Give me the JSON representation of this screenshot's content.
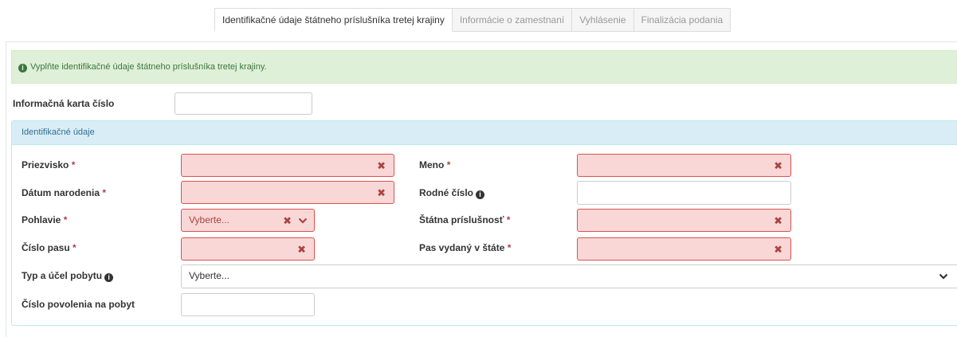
{
  "tabs": [
    {
      "label": "Identifikačné údaje štátneho príslušníka tretej krajiny",
      "active": true
    },
    {
      "label": "Informácie o zamestnaní",
      "active": false
    },
    {
      "label": "Vyhlásenie",
      "active": false
    },
    {
      "label": "Finalizácia podania",
      "active": false
    }
  ],
  "alert": {
    "icon": "info-circle-icon",
    "text": "Vyplňte identifikačné údaje štátneho príslušníka tretej krajiny.",
    "color": "#3c763d"
  },
  "info_card": {
    "label": "Informačná karta číslo",
    "value": ""
  },
  "panel": {
    "title": "Identifikačné údaje"
  },
  "fields": {
    "surname": {
      "label": "Priezvisko",
      "required": "*",
      "value": "",
      "error": true
    },
    "name": {
      "label": "Meno",
      "required": "*",
      "value": "",
      "error": true
    },
    "birth_date": {
      "label": "Dátum narodenia",
      "required": "*",
      "value": "",
      "error": true
    },
    "birth_number": {
      "label": "Rodné číslo",
      "value": "",
      "error": false
    },
    "gender": {
      "label": "Pohlavie",
      "required": "*",
      "selected": "Vyberte...",
      "error": true
    },
    "nationality": {
      "label": "Štátna príslušnosť",
      "required": "*",
      "value": "",
      "error": true
    },
    "passport_number": {
      "label": "Číslo pasu",
      "required": "*",
      "value": "",
      "error": true
    },
    "passport_state": {
      "label": "Pas vydaný v štáte",
      "required": "*",
      "value": "",
      "error": true
    },
    "stay_type": {
      "label": "Typ a účel pobytu",
      "selected": "Vyberte...",
      "error": false
    },
    "permit_number": {
      "label": "Číslo povolenia na pobyt",
      "value": "",
      "error": false
    }
  },
  "icons": {
    "clear": "✖",
    "help": "info-circle-icon"
  },
  "colors": {
    "error_border": "#d9534f",
    "error_bg": "#f8d7d6",
    "error_text": "#a94442",
    "panel_head_bg": "#d9edf7",
    "alert_bg": "#dff0d8"
  }
}
